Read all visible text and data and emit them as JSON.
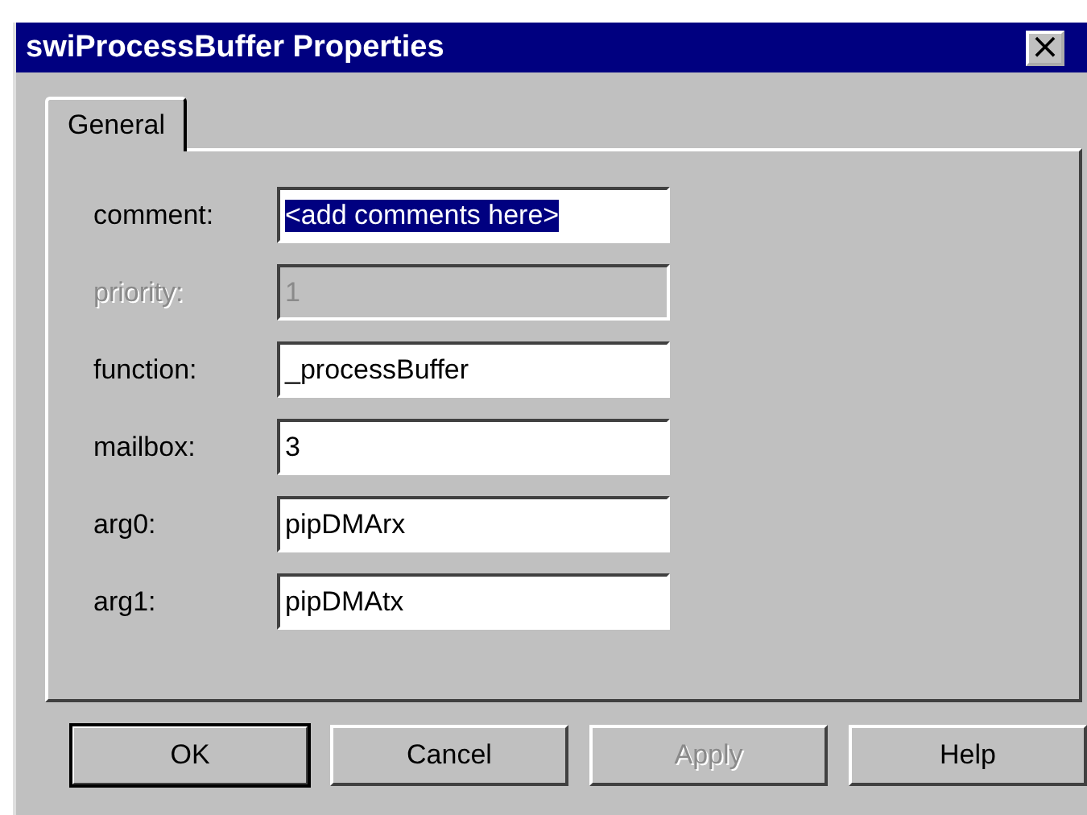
{
  "window": {
    "title": "swiProcessBuffer Properties",
    "close": "×"
  },
  "tabs": [
    {
      "label": "General",
      "selected": true
    }
  ],
  "fields": [
    {
      "label": "comment:",
      "value": "<add comments here>",
      "disabled": false,
      "text_selected": true
    },
    {
      "label": "priority:",
      "value": "1",
      "disabled": true,
      "text_selected": false
    },
    {
      "label": "function:",
      "value": "_processBuffer",
      "disabled": false,
      "text_selected": false
    },
    {
      "label": "mailbox:",
      "value": "3",
      "disabled": false,
      "text_selected": false
    },
    {
      "label": "arg0:",
      "value": "pipDMArx",
      "disabled": false,
      "text_selected": false
    },
    {
      "label": "arg1:",
      "value": "pipDMAtx",
      "disabled": false,
      "text_selected": false
    }
  ],
  "buttons": [
    {
      "label": "OK",
      "disabled": false,
      "default": true
    },
    {
      "label": "Cancel",
      "disabled": false,
      "default": false
    },
    {
      "label": "Apply",
      "disabled": true,
      "default": false
    },
    {
      "label": "Help",
      "disabled": false,
      "default": false
    }
  ]
}
